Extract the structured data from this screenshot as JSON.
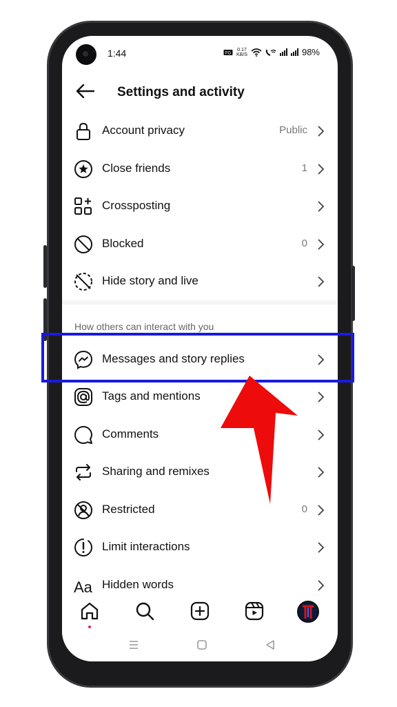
{
  "status_bar": {
    "time": "1:44",
    "net_speed": "0.17",
    "net_unit": "KB/S",
    "battery": "98%"
  },
  "header": {
    "title": "Settings and activity"
  },
  "items": [
    {
      "label": "Account privacy",
      "value": "Public"
    },
    {
      "label": "Close friends",
      "value": "1"
    },
    {
      "label": "Crossposting",
      "value": ""
    },
    {
      "label": "Blocked",
      "value": "0"
    },
    {
      "label": "Hide story and live",
      "value": ""
    }
  ],
  "section_title": "How others can interact with you",
  "interact_items": [
    {
      "label": "Messages and story replies",
      "value": ""
    },
    {
      "label": "Tags and mentions",
      "value": ""
    },
    {
      "label": "Comments",
      "value": ""
    },
    {
      "label": "Sharing and remixes",
      "value": ""
    },
    {
      "label": "Restricted",
      "value": "0"
    },
    {
      "label": "Limit interactions",
      "value": ""
    },
    {
      "label": "Hidden words",
      "value": ""
    }
  ],
  "icons": {
    "items": [
      "lock-icon",
      "star-circle-icon",
      "crosspost-grid-icon",
      "blocked-icon",
      "hide-story-icon"
    ],
    "interact_items": [
      "messenger-icon",
      "at-sign-icon",
      "comment-icon",
      "share-remix-icon",
      "restricted-icon",
      "limit-icon",
      "text-aa-icon"
    ],
    "nav": [
      "home-icon",
      "search-icon",
      "create-icon",
      "reels-icon",
      "profile-avatar"
    ]
  },
  "colors": {
    "highlight_box": "#1a1adf",
    "arrow": "#ee0b0b",
    "notification_dot": "#e0245e"
  }
}
